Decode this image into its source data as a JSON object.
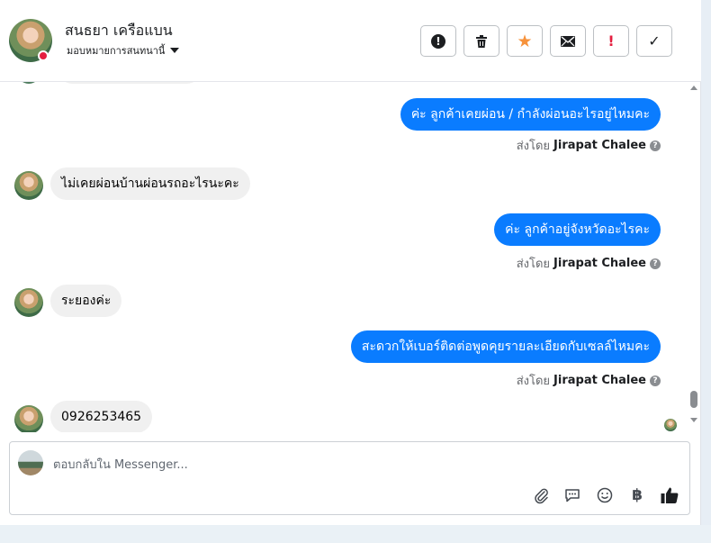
{
  "contact": {
    "name": "สนธยา เครือแบน",
    "assign_label": "มอบหมายการสนทนานี้"
  },
  "toolbar": [
    {
      "name": "spam-button",
      "glyph": "!",
      "color": "#1c1e21"
    },
    {
      "name": "delete-button",
      "glyph": "🗑",
      "color": "#1c1e21"
    },
    {
      "name": "star-button",
      "glyph": "★",
      "color": "#f7923b"
    },
    {
      "name": "mark-unread-button",
      "glyph": "✉",
      "color": "#1c1e21"
    },
    {
      "name": "important-button",
      "glyph": "!",
      "color": "#e41e3f"
    },
    {
      "name": "done-button",
      "glyph": "✓",
      "color": "#1c1e21"
    }
  ],
  "messages": [
    {
      "dir": "out",
      "text": "ค่ะ ลูกค้าเคยผ่อน / กำลังผ่อนอะไรอยู่ไหมคะ",
      "sent_by_label": "ส่งโดย",
      "sender": "Jirapat Chalee"
    },
    {
      "dir": "in",
      "text": "ไม่เคยผ่อนบ้านผ่อนรถอะไรนะคะ"
    },
    {
      "dir": "out",
      "text": "ค่ะ ลูกค้าอยู่จังหวัดอะไรคะ",
      "sent_by_label": "ส่งโดย",
      "sender": "Jirapat Chalee"
    },
    {
      "dir": "in",
      "text": "ระยองค่ะ"
    },
    {
      "dir": "out",
      "text": "สะดวกให้เบอร์ติดต่อพูดคุยรายละเอียดกับเซลล์ไหมคะ",
      "sent_by_label": "ส่งโดย",
      "sender": "Jirapat Chalee"
    },
    {
      "dir": "in",
      "text": "0926253465"
    }
  ],
  "composer": {
    "placeholder": "ตอบกลับใน Messenger...",
    "icons": [
      "paperclip-icon",
      "chat-bubble-icon",
      "emoji-icon",
      "baht-icon",
      "thumbs-up-icon"
    ]
  },
  "colors": {
    "outgoing_bubble": "#0a7cff",
    "incoming_bubble": "#f0f0f0",
    "star": "#f7923b",
    "important": "#e41e3f"
  }
}
